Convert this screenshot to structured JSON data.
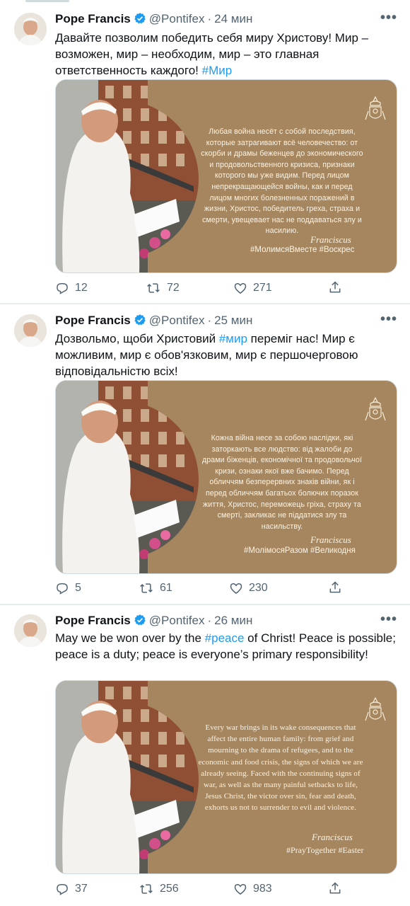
{
  "tweets": [
    {
      "author": "Pope Francis",
      "handle": "@Pontifex",
      "separator": "·",
      "time": "24 мин",
      "more": "•••",
      "text_parts": [
        "Давайте позволим победить себя миру Христову! Мир – возможен, мир – необходим, мир – это главная ответственность каждого! ",
        "#Мир"
      ],
      "card": {
        "quote": "Любая война несёт с собой последствия, которые затрагивают всё человечество: от скорби и драмы беженцев до экономического и продовольственного кризиса, признаки которого мы уже видим. Перед лицом непрекращающейся войны, как и перед лицом многих болезненных поражений в жизни, Христос, победитель греха, страха и смерти, увещевает нас не поддаваться злу и насилию.",
        "signature": "Franciscus",
        "tags": "#МолимсяВместе #Воскрес"
      },
      "replies": "12",
      "retweets": "72",
      "likes": "271"
    },
    {
      "author": "Pope Francis",
      "handle": "@Pontifex",
      "separator": "·",
      "time": "25 мин",
      "more": "•••",
      "text_parts": [
        "Дозвольмо, щоби Христовий ",
        "#мир",
        " переміг нас! Мир є можливим, мир є обов'язковим, мир є першочерговою відповідальністю всіх!"
      ],
      "card": {
        "quote": "Кожна війна несе за собою наслідки, які заторкають все людство: від жалоби до драми біженців, економічної та продовольчої кризи, ознаки якої вже бачимо. Перед обличчям безперервних знаків війни, як і перед обличчям багатьох болючих поразок життя, Христос, переможець гріха, страху та смерті, закликає не піддатися злу та насильству.",
        "signature": "Franciscus",
        "tags": "#МолімосяРазом #Великодня"
      },
      "replies": "5",
      "retweets": "61",
      "likes": "230"
    },
    {
      "author": "Pope Francis",
      "handle": "@Pontifex",
      "separator": "·",
      "time": "26 мин",
      "more": "•••",
      "text_parts": [
        "May we be won over by the ",
        "#peace",
        " of Christ! Peace is possible; peace is a duty; peace is everyone’s primary responsibility!"
      ],
      "card": {
        "quote": "Every war brings in its wake consequences that affect the entire human family: from grief and mourning to the drama of refugees, and to the economic and food crisis, the signs of which we are already seeing. Faced with the continuing signs of war, as well as the many painful setbacks to life, Jesus Christ, the victor over sin, fear and death, exhorts us not to surrender to evil and violence.",
        "signature": "Franciscus",
        "tags": "#PrayTogether #Easter"
      },
      "replies": "37",
      "retweets": "256",
      "likes": "983"
    }
  ],
  "colors": {
    "accent": "#1d9bf0",
    "card_background": "#a6865e",
    "secondary_text": "#536471"
  },
  "icons": [
    "verified-badge-icon",
    "more-icon",
    "reply-icon",
    "retweet-icon",
    "like-icon",
    "share-icon",
    "crest-icon"
  ]
}
